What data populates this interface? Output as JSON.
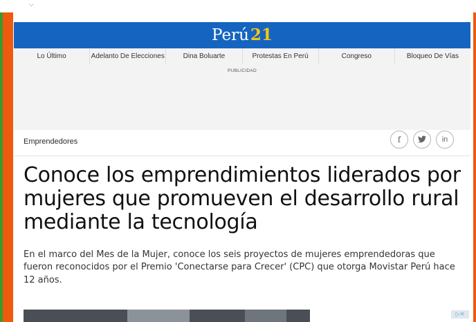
{
  "site": {
    "logo_text": "Perú",
    "logo_number": "21"
  },
  "nav": {
    "items": [
      {
        "label": "Lo Último"
      },
      {
        "label": "Adelanto De Elecciones"
      },
      {
        "label": "Dina Boluarte"
      },
      {
        "label": "Protestas En Perú"
      },
      {
        "label": "Congreso"
      },
      {
        "label": "Bloqueo De Vías"
      }
    ]
  },
  "ad": {
    "label": "PUBLICIDAD"
  },
  "article": {
    "section": "Emprendedores",
    "share": [
      {
        "icon": "facebook-icon",
        "glyph": "f"
      },
      {
        "icon": "twitter-icon",
        "glyph": "𝕥"
      },
      {
        "icon": "linkedin-icon",
        "glyph": "in"
      }
    ],
    "headline": "Conoce los emprendimientos liderados por mujeres que promueven el desarrollo rural mediante la tecnología",
    "summary": "En el marco del Mes de la Mujer, conoce los seis proyectos de mujeres emprendedoras que fueron reconocidos por el Premio 'Conectarse para Crecer' (CPC) que otorga Movistar Perú hace 12 años."
  },
  "colors": {
    "brand_blue": "#1565c0",
    "brand_yellow": "#f9c413",
    "side_orange": "#ee5a0e",
    "edge_green": "#3a9a2e"
  }
}
